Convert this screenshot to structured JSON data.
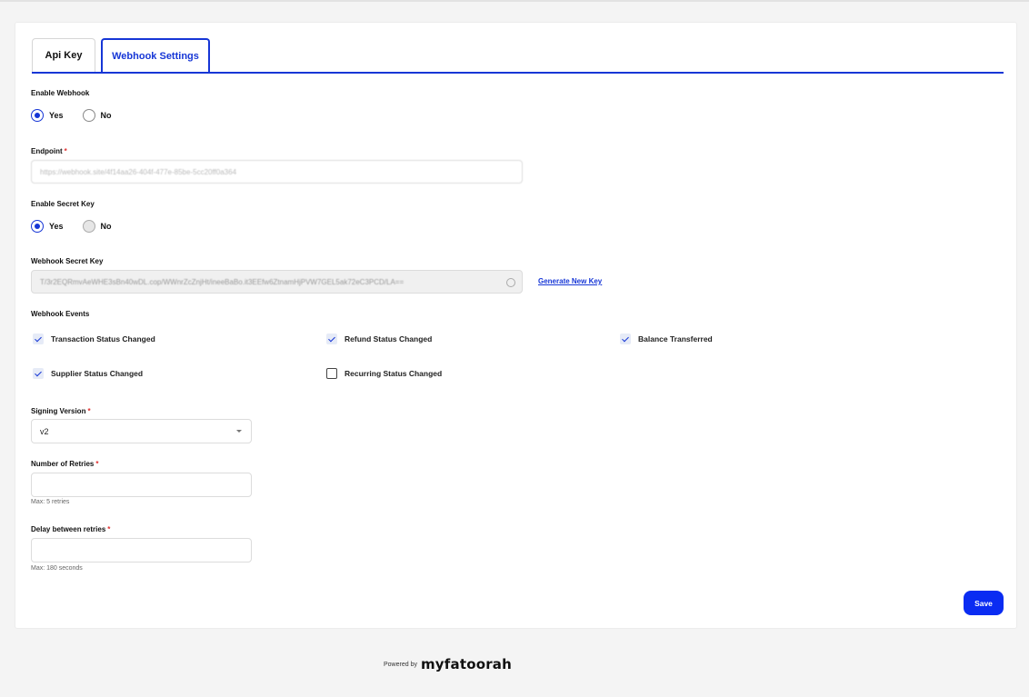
{
  "tabs": {
    "api_key": "Api Key",
    "webhook_settings": "Webhook Settings"
  },
  "enable_webhook": {
    "label": "Enable Webhook",
    "yes": "Yes",
    "no": "No",
    "selected": "Yes"
  },
  "endpoint": {
    "label": "Endpoint",
    "required": "*",
    "value": "https://webhook.site/4f14aa26-404f-477e-85be-5cc20ff0a364"
  },
  "enable_secret_key": {
    "label": "Enable Secret Key",
    "yes": "Yes",
    "no": "No",
    "selected": "Yes"
  },
  "secret_key": {
    "label": "Webhook Secret Key",
    "value": "T/3r2EQRmvAeWHE3sBn40wDL.cop/WWnrZcZnjHt/ineeBaBo.it3EEfw6ZtnamHjPVW7GEL5ak72eC3PCD/LA==",
    "generate_label": "Generate New Key"
  },
  "events": {
    "label": "Webhook Events",
    "items": [
      {
        "label": "Transaction Status Changed",
        "checked": true
      },
      {
        "label": "Refund Status Changed",
        "checked": true
      },
      {
        "label": "Balance Transferred",
        "checked": true
      },
      {
        "label": "Supplier Status Changed",
        "checked": true
      },
      {
        "label": "Recurring Status Changed",
        "checked": false
      }
    ]
  },
  "signing_version": {
    "label": "Signing Version",
    "required": "*",
    "value": "v2"
  },
  "retries": {
    "label": "Number of Retries",
    "required": "*",
    "value": "",
    "hint": "Max: 5 retries"
  },
  "delay": {
    "label": "Delay between retries",
    "required": "*",
    "value": "",
    "hint": "Max: 180 seconds"
  },
  "save_label": "Save",
  "footer": {
    "powered_by": "Powered by",
    "brand": "myfatoorah"
  },
  "colors": {
    "accent": "#1636d6",
    "save_button": "#0a2cf2",
    "required": "#e03030"
  }
}
